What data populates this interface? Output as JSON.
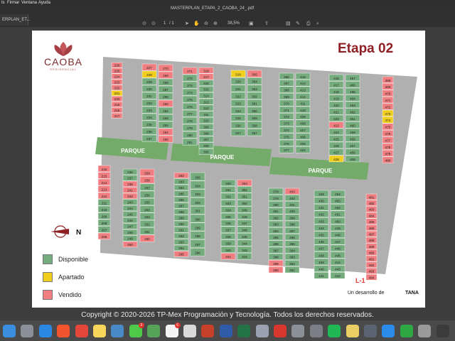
{
  "menubar": {
    "items": [
      "ts",
      "Firmar",
      "Ventana",
      "Ayuda"
    ]
  },
  "toolbar": {
    "tab_title": "MASTERPLAN_ETAPA_2_CAOBA_24_.pdf",
    "tab_left": "ERPLAN_ET...",
    "page_current": "1",
    "page_total": "/ 1",
    "zoom": "38,5%"
  },
  "logo": {
    "name": "CAOBA",
    "sub": "RESIDENCIAL"
  },
  "heading": "Etapa 02",
  "park_label": "PARQUE",
  "compass": "N",
  "legend": [
    {
      "label": "Disponible",
      "color": "#74ac7d"
    },
    {
      "label": "Apartado",
      "color": "#f0ce1e"
    },
    {
      "label": "Vendido",
      "color": "#f07d7f"
    }
  ],
  "colors": {
    "disponible": "#74ac7d",
    "apartado": "#f0ce1e",
    "vendido": "#f07d7f",
    "park": "#75ab6a",
    "frame": "#b0b0b0"
  },
  "annotation": "L-1",
  "developer": "Un desarrollo de",
  "developer_brand": "TANA",
  "copyright": "Copyright © 2020-2026 TP-Mex Programación y Tecnología. Todos los derechos reservados.",
  "dock": [
    {
      "name": "finder-icon",
      "color": "#3b8ede"
    },
    {
      "name": "launchpad-icon",
      "color": "#8a8f9a"
    },
    {
      "name": "safari-icon",
      "color": "#2b88e3"
    },
    {
      "name": "brave-icon",
      "color": "#f2552d"
    },
    {
      "name": "chrome-icon",
      "color": "#e4473a"
    },
    {
      "name": "notes-icon",
      "color": "#f7d65a"
    },
    {
      "name": "photos-icon",
      "color": "#4a89c8"
    },
    {
      "name": "messages-icon",
      "color": "#4ec94a",
      "badge": "3"
    },
    {
      "name": "maps-icon",
      "color": "#56a45a"
    },
    {
      "name": "calendar-icon",
      "color": "#f4f4f4",
      "badge": "6"
    },
    {
      "name": "reminders-icon",
      "color": "#d9d9d9"
    },
    {
      "name": "powerpoint-icon",
      "color": "#c6402a"
    },
    {
      "name": "word-icon",
      "color": "#2f5ba9"
    },
    {
      "name": "excel-icon",
      "color": "#227447"
    },
    {
      "name": "wifi-icon",
      "color": "#9aa2b1"
    },
    {
      "name": "acrobat-icon",
      "color": "#d7372d"
    },
    {
      "name": "preview-icon",
      "color": "#8b8f98"
    },
    {
      "name": "settings-icon",
      "color": "#7b7e86"
    },
    {
      "name": "spotify-icon",
      "color": "#1fb855"
    },
    {
      "name": "stickies-icon",
      "color": "#e9cf63"
    },
    {
      "name": "screenshot-icon",
      "color": "#5a6470"
    },
    {
      "name": "appstore-icon",
      "color": "#2b8be8"
    },
    {
      "name": "facetime-icon",
      "color": "#2ea843"
    },
    {
      "name": "trash-icon",
      "color": "#9a9a9a"
    },
    {
      "name": "extra-icon",
      "color": "#3b3b3b"
    }
  ],
  "lots": {
    "topA": {
      "left": [
        226,
        225,
        224,
        223,
        222,
        221,
        220,
        219,
        218,
        217
      ],
      "mid": [
        227,
        228,
        229,
        230,
        231,
        232,
        233,
        234,
        235,
        236,
        237
      ],
      "right": [
        270,
        269,
        268,
        267,
        266,
        265,
        264,
        263,
        262,
        261,
        260
      ]
    },
    "topB": {
      "left": [
        271,
        272,
        273,
        274,
        275,
        276,
        277,
        278,
        279,
        280,
        281
      ],
      "right": [
        318,
        317,
        316,
        315,
        314,
        313,
        312,
        311,
        310,
        309,
        308,
        307,
        306,
        305
      ]
    },
    "topC": {
      "left": [
        319,
        320,
        321,
        322,
        323,
        324,
        325,
        326,
        327
      ],
      "right": [
        365,
        364,
        363,
        362,
        361,
        360,
        359,
        358,
        357
      ]
    },
    "topD": {
      "left": [
        366,
        367,
        368,
        369,
        370,
        371,
        372,
        373,
        374,
        375,
        376,
        377
      ],
      "right": [
        415,
        414,
        413,
        412,
        411,
        410,
        409,
        408,
        407,
        406,
        405,
        404
      ]
    },
    "topE": {
      "left": [
        416,
        417,
        418,
        419,
        420,
        421,
        422,
        423,
        424,
        425,
        426,
        427,
        428
      ],
      "right": [
        467,
        466,
        465,
        464,
        463,
        462,
        461,
        460,
        459,
        458,
        457,
        456,
        455
      ]
    },
    "topF": {
      "right": [
        468,
        469,
        470,
        471,
        472,
        473,
        474,
        475,
        476,
        477,
        478,
        479,
        480
      ]
    },
    "botA": {
      "left": [
        216,
        215,
        214,
        213,
        212,
        211,
        210,
        209,
        208,
        207,
        206
      ],
      "mid": [
        236,
        237,
        238,
        241,
        242,
        243,
        244,
        245,
        246,
        247,
        248,
        249,
        250
      ],
      "right": [
        259,
        258,
        257,
        256,
        255,
        254,
        253,
        252,
        251,
        250
      ]
    },
    "botB": {
      "left": [
        282,
        283,
        284,
        285,
        286,
        287,
        288,
        289,
        290,
        291,
        292,
        293,
        294,
        295
      ],
      "right": [
        305,
        304,
        303,
        302,
        301,
        300,
        299,
        298,
        297,
        296
      ]
    },
    "botC": {
      "left": [
        330,
        331,
        332,
        333,
        334,
        335,
        336,
        337,
        338,
        339,
        340,
        341
      ],
      "right": [
        353,
        352,
        351,
        350,
        349,
        348,
        347,
        346,
        345,
        344,
        343,
        342
      ]
    },
    "botD": {
      "left": [
        378,
        379,
        380,
        381,
        382,
        383,
        384,
        385,
        386,
        387,
        388,
        389,
        390
      ],
      "right": [
        403,
        402,
        401,
        400,
        399,
        398,
        397,
        396,
        395,
        394,
        393,
        392,
        391
      ]
    },
    "botE": {
      "left": [
        429,
        430,
        431,
        432,
        433,
        434,
        435,
        436,
        437,
        438,
        439,
        440,
        441
      ],
      "right": [
        454,
        453,
        452,
        451,
        450,
        449,
        448,
        447,
        446,
        445,
        444,
        443,
        442
      ]
    },
    "botF": {
      "right": [
        481,
        482,
        483,
        484,
        485,
        486,
        487,
        488,
        489,
        490,
        491,
        492,
        493,
        494
      ]
    }
  },
  "status": {
    "apartado": [
      228,
      221,
      319,
      473,
      474,
      428
    ],
    "disponible": [
      229,
      230,
      231,
      232,
      233,
      234,
      235,
      236,
      237,
      262,
      263,
      264,
      266,
      267,
      268,
      272,
      273,
      274,
      275,
      276,
      277,
      278,
      279,
      280,
      281,
      305,
      306,
      307,
      308,
      309,
      310,
      311,
      312,
      313,
      314,
      315,
      316,
      320,
      321,
      322,
      323,
      324,
      325,
      326,
      327,
      357,
      358,
      359,
      360,
      361,
      362,
      363,
      364,
      366,
      367,
      368,
      369,
      370,
      371,
      372,
      373,
      374,
      375,
      376,
      377,
      404,
      405,
      406,
      407,
      408,
      409,
      410,
      411,
      412,
      413,
      414,
      415,
      416,
      417,
      418,
      419,
      420,
      421,
      422,
      424,
      425,
      426,
      427,
      455,
      456,
      457,
      458,
      459,
      460,
      461,
      462,
      463,
      464,
      465,
      466,
      467,
      207,
      208,
      209,
      210,
      211,
      243,
      244,
      245,
      246,
      247,
      248,
      249,
      251,
      252,
      253,
      254,
      255,
      256,
      257,
      283,
      284,
      285,
      286,
      287,
      288,
      289,
      290,
      291,
      292,
      293,
      294,
      296,
      297,
      298,
      299,
      300,
      301,
      302,
      303,
      304,
      330,
      331,
      332,
      333,
      334,
      335,
      336,
      337,
      338,
      339,
      340,
      342,
      343,
      344,
      345,
      346,
      347,
      348,
      349,
      350,
      351,
      352,
      378,
      379,
      380,
      381,
      382,
      383,
      384,
      385,
      386,
      387,
      388,
      391,
      392,
      393,
      394,
      395,
      396,
      397,
      398,
      399,
      400,
      401,
      402,
      429,
      430,
      431,
      432,
      433,
      434,
      435,
      436,
      437,
      438,
      439,
      440,
      441,
      442,
      443,
      444,
      445,
      446,
      447,
      448,
      449,
      450,
      451,
      452,
      453,
      454
    ]
  }
}
